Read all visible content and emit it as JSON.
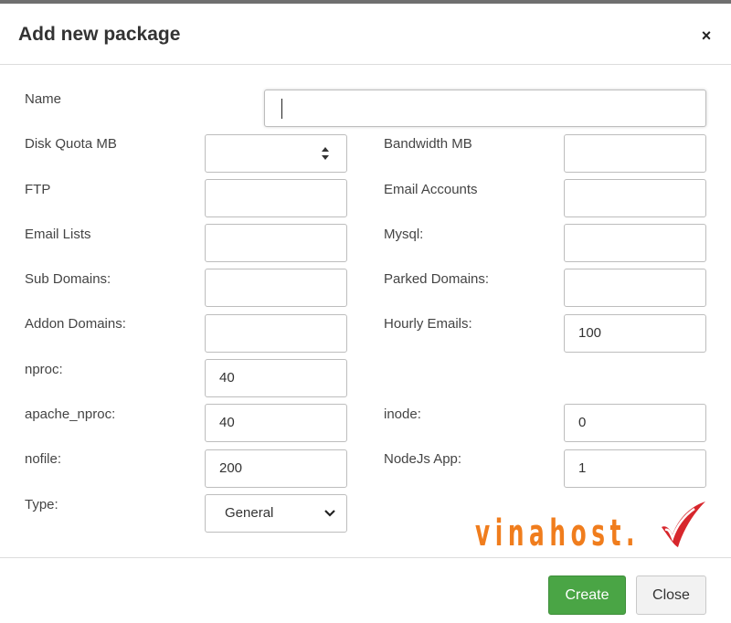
{
  "dialog": {
    "title": "Add new package",
    "close_icon": "×"
  },
  "form": {
    "name": {
      "label": "Name",
      "value": ""
    },
    "disk_quota": {
      "label": "Disk Quota MB",
      "value": ""
    },
    "bandwidth": {
      "label": "Bandwidth MB",
      "value": ""
    },
    "ftp": {
      "label": "FTP",
      "value": ""
    },
    "email_accounts": {
      "label": "Email Accounts",
      "value": ""
    },
    "email_lists": {
      "label": "Email Lists",
      "value": ""
    },
    "mysql": {
      "label": "Mysql:",
      "value": ""
    },
    "sub_domains": {
      "label": "Sub Domains:",
      "value": ""
    },
    "parked_domains": {
      "label": "Parked Domains:",
      "value": ""
    },
    "addon_domains": {
      "label": "Addon Domains:",
      "value": ""
    },
    "hourly_emails": {
      "label": "Hourly Emails:",
      "value": "100"
    },
    "nproc": {
      "label": "nproc:",
      "value": "40"
    },
    "apache_nproc": {
      "label": "apache_nproc:",
      "value": "40"
    },
    "inode": {
      "label": "inode:",
      "value": "0"
    },
    "nofile": {
      "label": "nofile:",
      "value": "200"
    },
    "nodejs_app": {
      "label": "NodeJs App:",
      "value": "1"
    },
    "type": {
      "label": "Type:",
      "selected": "General"
    }
  },
  "footer": {
    "create_label": "Create",
    "close_label": "Close"
  },
  "watermark": {
    "text": "vinahost."
  },
  "colors": {
    "create_button": "#4aa545",
    "watermark_orange": "#f07d1d",
    "watermark_red": "#d7262c"
  }
}
